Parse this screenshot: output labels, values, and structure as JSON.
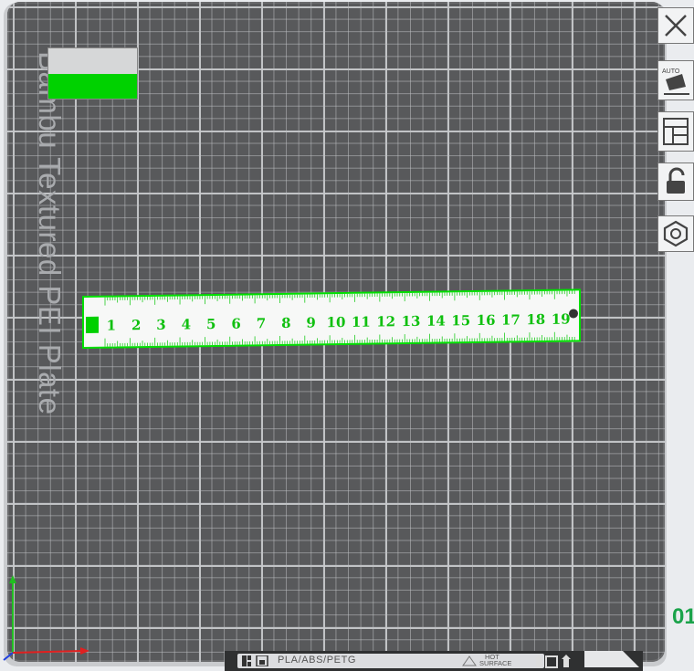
{
  "plate": {
    "label": "Bambu Textured PEI Plate",
    "badge_filaments": "PLA/ABS/PETG",
    "badge_hot_line1": "HOT",
    "badge_hot_line2": "SURFACE"
  },
  "ruler": {
    "numbers": [
      "1",
      "2",
      "3",
      "4",
      "5",
      "6",
      "7",
      "8",
      "9",
      "10",
      "11",
      "12",
      "13",
      "14",
      "15",
      "16",
      "17",
      "18",
      "19"
    ],
    "tick_color": "#22cc22",
    "outline_color": "#00e000"
  },
  "toolbar": {
    "close_icon": "close-icon",
    "auto_orient_label": "AUTO",
    "arrange_icon": "arrange-icon",
    "lock_icon": "lock-icon",
    "settings_icon": "hex-nut-icon"
  },
  "side_value": "01",
  "colors": {
    "plate": "#58595b",
    "filament_green": "#00d200",
    "axis_x": "#e02020",
    "axis_y": "#20c020"
  }
}
